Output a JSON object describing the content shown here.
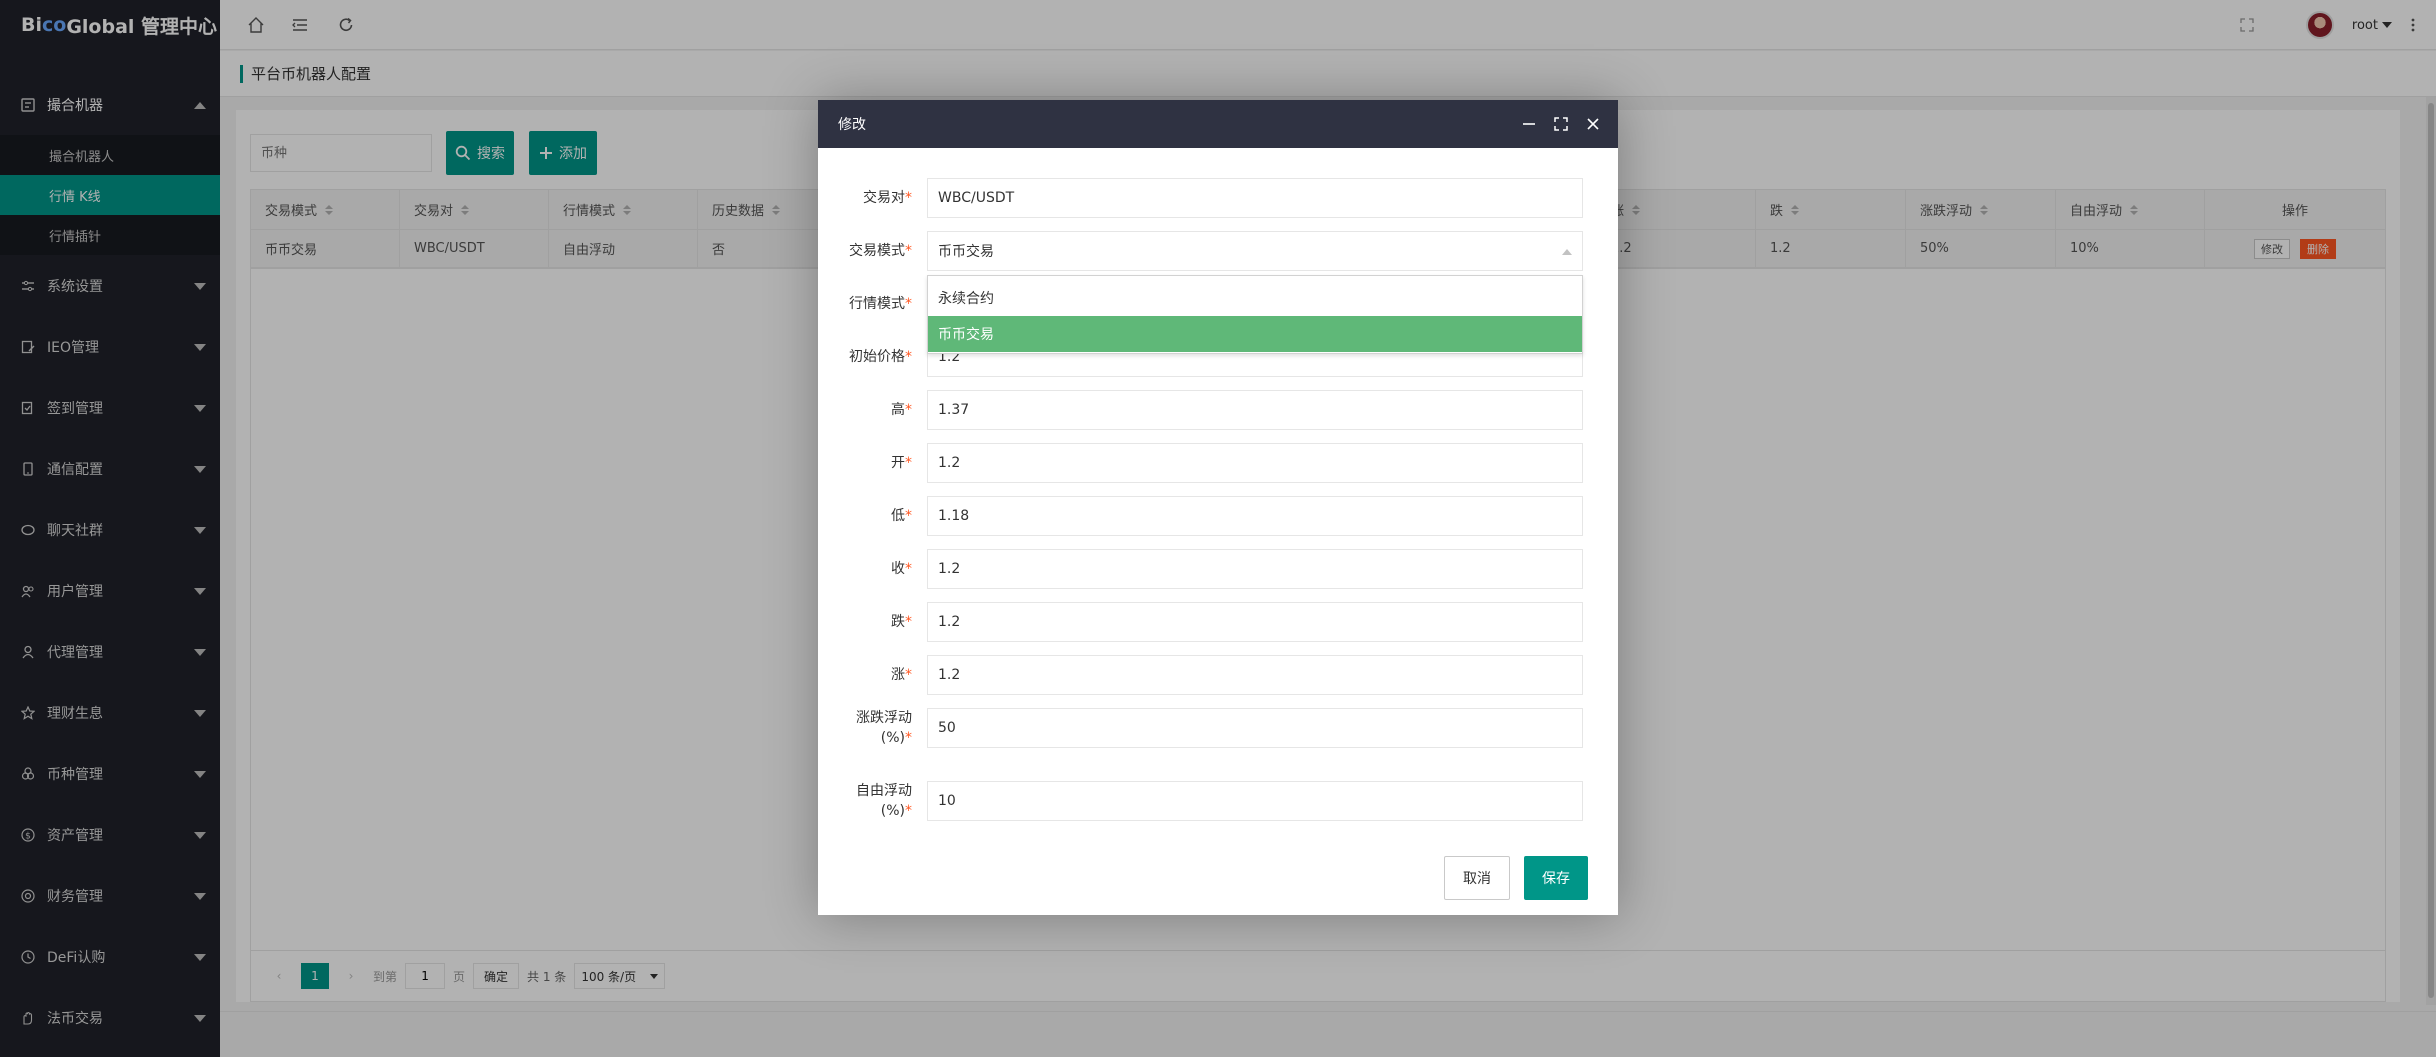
{
  "app": {
    "logo_bi": "Bi",
    "logo_co": "co",
    "logo_rest": " Global 管理中心"
  },
  "header": {
    "username": "root"
  },
  "sidebar": {
    "items": [
      {
        "label": "撮合机器",
        "icon": "robot-icon",
        "open": true
      },
      {
        "label": "系统设置",
        "icon": "sliders-icon"
      },
      {
        "label": "IEO管理",
        "icon": "edit-doc-icon"
      },
      {
        "label": "签到管理",
        "icon": "checkin-icon"
      },
      {
        "label": "通信配置",
        "icon": "phone-icon"
      },
      {
        "label": "聊天社群",
        "icon": "chat-icon"
      },
      {
        "label": "用户管理",
        "icon": "users-icon"
      },
      {
        "label": "代理管理",
        "icon": "agent-icon"
      },
      {
        "label": "理财生息",
        "icon": "star-icon"
      },
      {
        "label": "币种管理",
        "icon": "coins-icon"
      },
      {
        "label": "资产管理",
        "icon": "dollar-icon"
      },
      {
        "label": "财务管理",
        "icon": "finance-icon"
      },
      {
        "label": "DeFi认购",
        "icon": "clock-icon"
      },
      {
        "label": "法币交易",
        "icon": "hand-icon"
      }
    ],
    "submenu": [
      {
        "label": "撮合机器人"
      },
      {
        "label": "行情 K线",
        "active": true
      },
      {
        "label": "行情插针"
      }
    ]
  },
  "page": {
    "breadcrumb": "平台币机器人配置",
    "search_placeholder": "币种",
    "search_button": "搜索",
    "add_button": "添加"
  },
  "table": {
    "columns": [
      "交易模式",
      "交易对",
      "行情模式",
      "历史数据",
      "涨",
      "跌",
      "涨跌浮动",
      "自由浮动",
      "操作"
    ],
    "row": {
      "mode": "币币交易",
      "pair": "WBC/USDT",
      "market_mode": "自由浮动",
      "history": "否",
      "rise": "1.2",
      "fall": "1.2",
      "float": "50%",
      "free_float": "10%",
      "edit": "修改",
      "delete": "删除"
    }
  },
  "pager": {
    "current_page": "1",
    "goto_label": "到第",
    "goto_value": "1",
    "page_label": "页",
    "ok_label": "确定",
    "total": "共 1 条",
    "per_page": "100 条/页"
  },
  "modal": {
    "title": "修改",
    "fields": {
      "pair": {
        "label": "交易对",
        "value": "WBC/USDT"
      },
      "mode": {
        "label": "交易模式",
        "value": "币币交易"
      },
      "market_mode": {
        "label": "行情模式"
      },
      "initial_price": {
        "label": "初始价格",
        "value": "1.2"
      },
      "high": {
        "label": "高",
        "value": "1.37"
      },
      "open": {
        "label": "开",
        "value": "1.2"
      },
      "low": {
        "label": "低",
        "value": "1.18"
      },
      "close": {
        "label": "收",
        "value": "1.2"
      },
      "fall": {
        "label": "跌",
        "value": "1.2"
      },
      "rise": {
        "label": "涨",
        "value": "1.2"
      },
      "float_pct": {
        "label_1": "涨跌浮动",
        "label_2": "(%)",
        "value": "50"
      },
      "free_float_pct": {
        "label_1": "自由浮动",
        "label_2": "(%)",
        "value": "10"
      }
    },
    "dropdown_options": [
      "永续合约",
      "币币交易"
    ],
    "cancel_label": "取消",
    "save_label": "保存"
  },
  "colors": {
    "accent": "#009688",
    "danger": "#ff5722",
    "selected_option": "#5fb878",
    "sidebar_bg": "#20222a",
    "modal_header": "#2f3242"
  }
}
